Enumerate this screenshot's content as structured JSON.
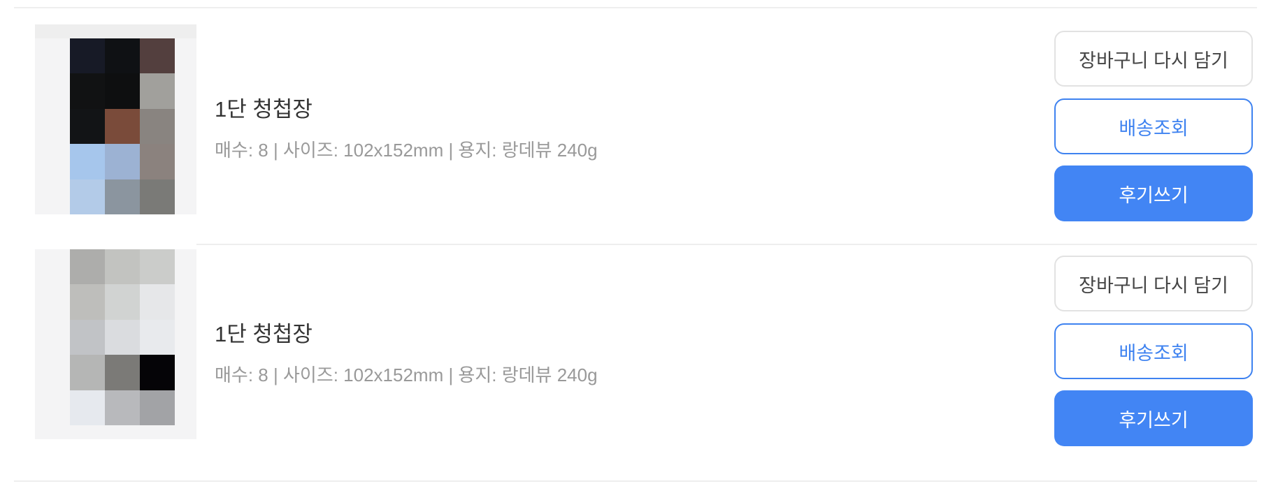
{
  "orders": [
    {
      "title": "1단 청첩장",
      "meta": "매수: 8 | 사이즈: 102x152mm | 용지: 랑데뷰 240g",
      "buttons": {
        "cart": "장바구니 다시 담기",
        "track": "배송조회",
        "review": "후기쓰기"
      },
      "thumbnail_colors": [
        [
          "#171a26",
          "#0f1114",
          "#533f3e"
        ],
        [
          "#111213",
          "#0e0f10",
          "#a1a09c"
        ],
        [
          "#121416",
          "#7a4b3a",
          "#898480"
        ],
        [
          "#a6c6ec",
          "#9cb2d3",
          "#8b827e"
        ],
        [
          "#b3cbe8",
          "#8b959f",
          "#7a7a77"
        ]
      ]
    },
    {
      "title": "1단 청첩장",
      "meta": "매수: 8 | 사이즈: 102x152mm | 용지: 랑데뷰 240g",
      "buttons": {
        "cart": "장바구니 다시 담기",
        "track": "배송조회",
        "review": "후기쓰기"
      },
      "thumbnail_colors": [
        [
          "#adadab",
          "#c2c3c0",
          "#cbccca"
        ],
        [
          "#bebebb",
          "#d1d3d2",
          "#e6e7e9"
        ],
        [
          "#c1c3c6",
          "#dadcdf",
          "#e8eaed"
        ],
        [
          "#b5b6b5",
          "#7b7a77",
          "#050407"
        ],
        [
          "#e6e9ee",
          "#b8b9bc",
          "#a2a3a6"
        ]
      ]
    }
  ]
}
